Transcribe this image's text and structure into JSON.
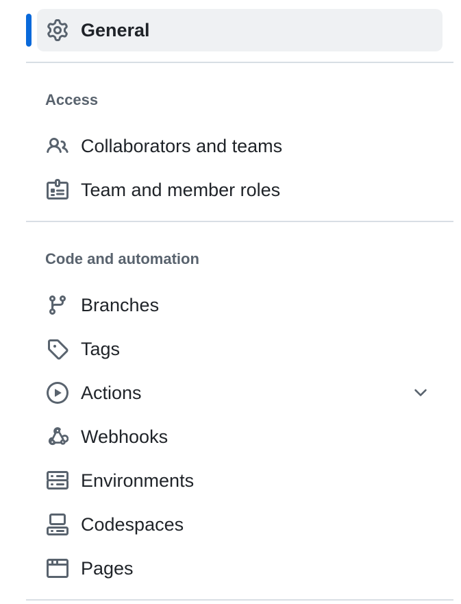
{
  "nav": {
    "general": {
      "label": "General",
      "icon": "gear-icon",
      "active": true
    },
    "access": {
      "heading": "Access",
      "items": [
        {
          "label": "Collaborators and teams",
          "icon": "people-icon"
        },
        {
          "label": "Team and member roles",
          "icon": "id-badge-icon"
        }
      ]
    },
    "code_automation": {
      "heading": "Code and automation",
      "items": [
        {
          "label": "Branches",
          "icon": "git-branch-icon"
        },
        {
          "label": "Tags",
          "icon": "tag-icon"
        },
        {
          "label": "Actions",
          "icon": "play-icon",
          "expandable": true
        },
        {
          "label": "Webhooks",
          "icon": "webhook-icon"
        },
        {
          "label": "Environments",
          "icon": "server-icon"
        },
        {
          "label": "Codespaces",
          "icon": "codespaces-icon"
        },
        {
          "label": "Pages",
          "icon": "browser-icon"
        }
      ]
    }
  },
  "colors": {
    "accent": "#0969da",
    "active_bg": "#eff1f3",
    "text": "#1f2328",
    "muted": "#59636e",
    "divider": "#d8dee4"
  }
}
